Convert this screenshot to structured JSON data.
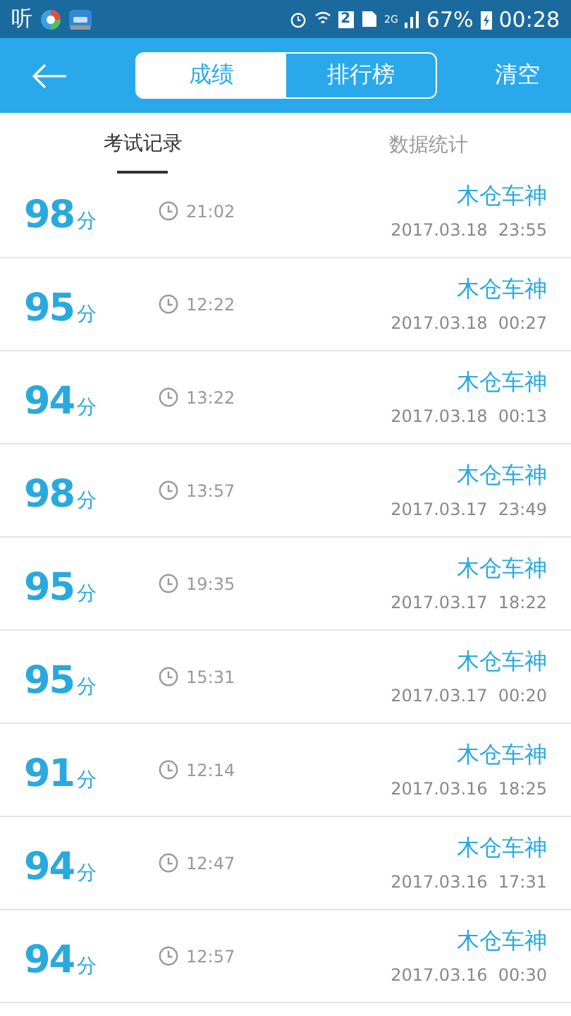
{
  "status_bar": {
    "app_label": "听",
    "sim_badge": "2",
    "network": "2G",
    "battery": "67%",
    "time": "00:28"
  },
  "app_bar": {
    "segments": [
      {
        "label": "成绩",
        "selected": true
      },
      {
        "label": "排行榜",
        "selected": false
      }
    ],
    "action": "清空"
  },
  "tabs": [
    {
      "label": "考试记录",
      "selected": true
    },
    {
      "label": "数据统计",
      "selected": false
    }
  ],
  "records": [
    {
      "score": "98",
      "unit": "分",
      "duration": "21:02",
      "name": "木仓车神",
      "date": "2017.03.18  23:55"
    },
    {
      "score": "95",
      "unit": "分",
      "duration": "12:22",
      "name": "木仓车神",
      "date": "2017.03.18  00:27"
    },
    {
      "score": "94",
      "unit": "分",
      "duration": "13:22",
      "name": "木仓车神",
      "date": "2017.03.18  00:13"
    },
    {
      "score": "98",
      "unit": "分",
      "duration": "13:57",
      "name": "木仓车神",
      "date": "2017.03.17  23:49"
    },
    {
      "score": "95",
      "unit": "分",
      "duration": "19:35",
      "name": "木仓车神",
      "date": "2017.03.17  18:22"
    },
    {
      "score": "95",
      "unit": "分",
      "duration": "15:31",
      "name": "木仓车神",
      "date": "2017.03.17  00:20"
    },
    {
      "score": "91",
      "unit": "分",
      "duration": "12:14",
      "name": "木仓车神",
      "date": "2017.03.16  18:25"
    },
    {
      "score": "94",
      "unit": "分",
      "duration": "12:47",
      "name": "木仓车神",
      "date": "2017.03.16  17:31"
    },
    {
      "score": "94",
      "unit": "分",
      "duration": "12:57",
      "name": "木仓车神",
      "date": "2017.03.16  00:30"
    }
  ]
}
